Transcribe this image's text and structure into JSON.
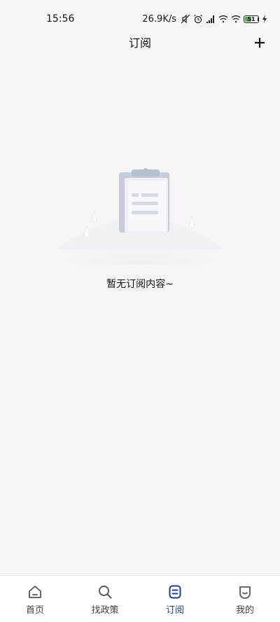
{
  "status_bar": {
    "time": "15:56",
    "net_speed": "26.9K/s",
    "battery_level": "51",
    "battery_percent": 51
  },
  "header": {
    "title": "订阅",
    "add_icon": "plus-icon"
  },
  "empty_state": {
    "message": "暂无订阅内容~",
    "illustration": "clipboard-illustration"
  },
  "tabbar": {
    "items": [
      {
        "label": "首页",
        "icon": "home-icon",
        "active": false
      },
      {
        "label": "找政策",
        "icon": "search-icon",
        "active": false
      },
      {
        "label": "订阅",
        "icon": "subscription-icon",
        "active": true
      },
      {
        "label": "我的",
        "icon": "profile-icon",
        "active": false
      }
    ]
  },
  "colors": {
    "background": "#f5f5f5",
    "accent": "#1e3c8c",
    "tab_inactive": "#444444"
  }
}
